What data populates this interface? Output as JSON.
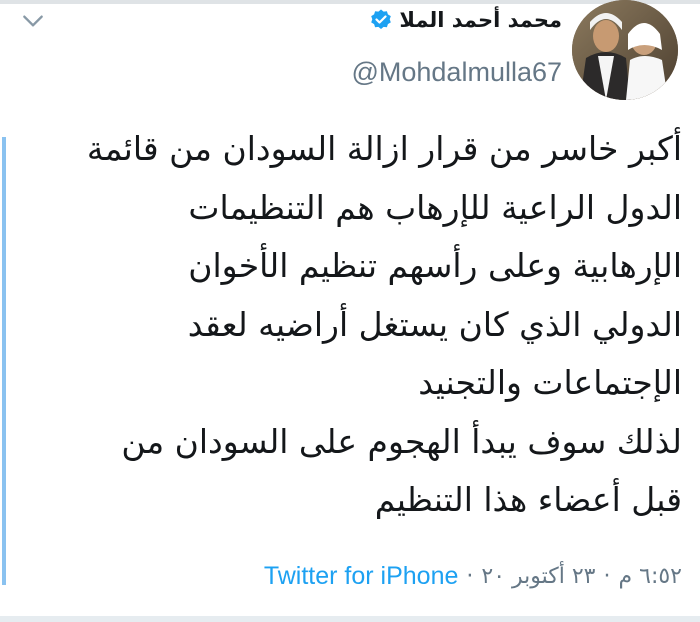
{
  "tweet": {
    "author": {
      "display_name": "محمد أحمد الملا",
      "handle": "@Mohdalmulla67",
      "verified_icon": "verified-badge-icon",
      "avatar_icon": "avatar"
    },
    "lines": [
      "أكبر خاسر من قرار ازالة السودان من قائمة",
      "الدول الراعية للإرهاب هم التنظيمات",
      "الإرهابية وعلى رأسهم تنظيم الأخوان",
      "الدولي الذي كان يستغل أراضيه لعقد",
      "الإجتماعات والتجنيد",
      "لذلك سوف يبدأ الهجوم على السودان من",
      "قبل أعضاء هذا التنظيم"
    ],
    "time": "٦:٥٢ م",
    "separator": "·",
    "date": "٢٣ أكتوبر ٢٠",
    "source": "Twitter for iPhone"
  },
  "icons": {
    "menu_chevron": "chevron-down-icon"
  },
  "colors": {
    "text_primary": "#14171a",
    "text_secondary": "#657786",
    "link_blue": "#1da1f2",
    "verified_blue": "#1da1f2",
    "accent_bar": "#8ac2f0"
  }
}
